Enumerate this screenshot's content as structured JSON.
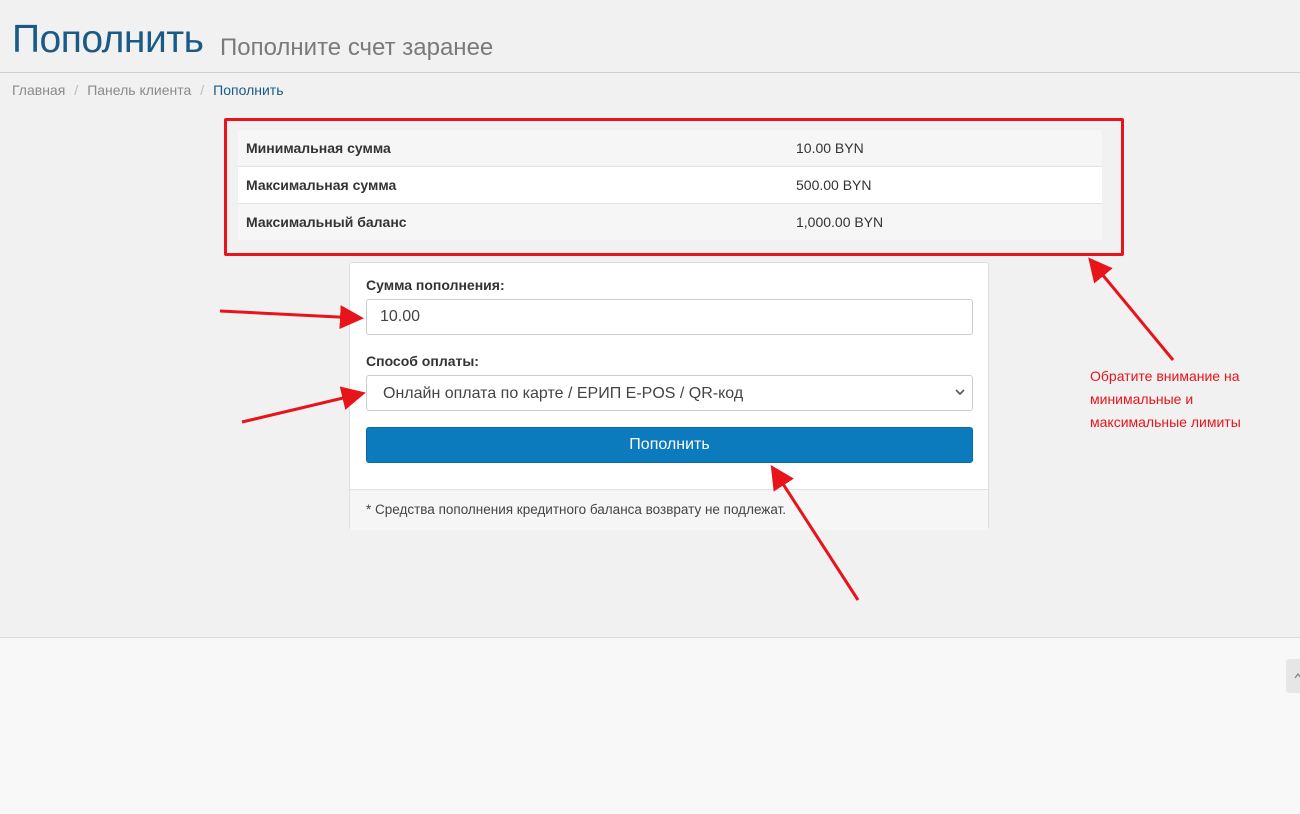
{
  "header": {
    "title": "Пополнить",
    "subtitle": "Пополните счет заранее"
  },
  "breadcrumb": {
    "items": [
      "Главная",
      "Панель клиента",
      "Пополнить"
    ],
    "separator": "/"
  },
  "limits": [
    {
      "label": "Минимальная сумма",
      "value": "10.00 BYN"
    },
    {
      "label": "Максимальная сумма",
      "value": "500.00 BYN"
    },
    {
      "label": "Максимальный баланс",
      "value": "1,000.00 BYN"
    }
  ],
  "form": {
    "amount_label": "Сумма пополнения:",
    "amount_value": "10.00",
    "method_label": "Способ оплаты:",
    "method_selected": "Онлайн оплата по карте / ЕРИП E-POS / QR-код",
    "submit_label": "Пополнить",
    "footnote": "* Средства пополнения кредитного баланса возврату не подлежат."
  },
  "annotation": {
    "text": "Обратите внимание на минимальные и максимальные лимиты"
  },
  "colors": {
    "title": "#1a5a86",
    "primary_button": "#0c7bbd",
    "annotation_red": "#e8141b"
  },
  "icons": {
    "select_chevron": "chevron-down-icon",
    "scroll_top": "chevron-up-icon"
  }
}
